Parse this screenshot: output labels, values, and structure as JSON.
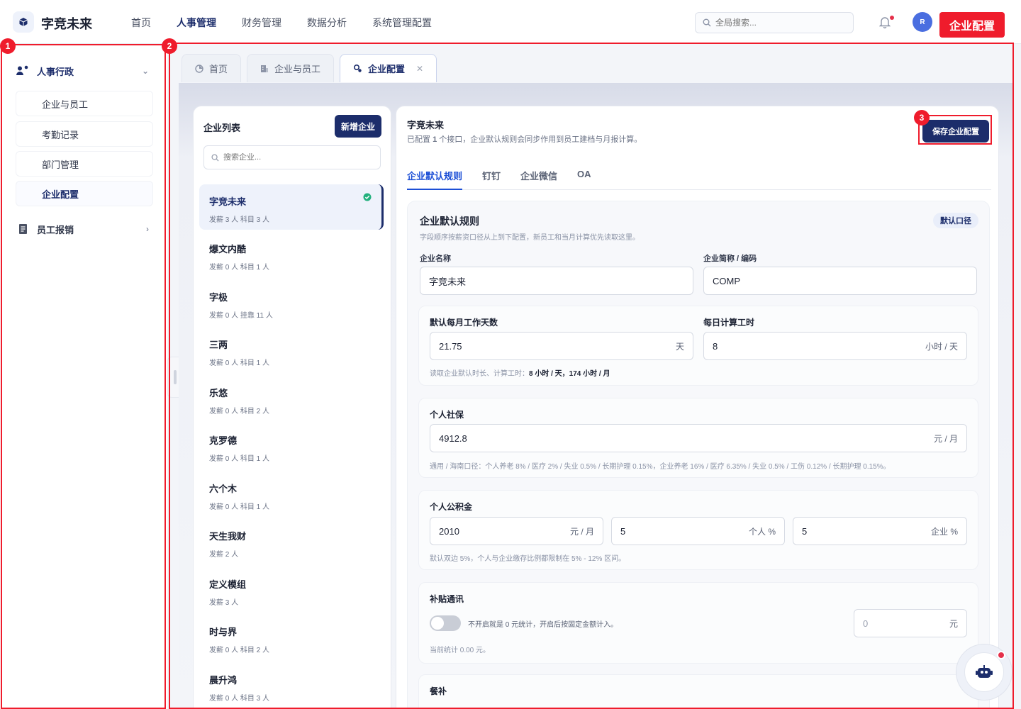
{
  "header": {
    "brand": "字竞未来",
    "nav": [
      "首页",
      "人事管理",
      "财务管理",
      "数据分析",
      "系统管理配置"
    ],
    "active_nav": 1,
    "search_placeholder": "全局搜索...",
    "avatar_initial": "R",
    "highlight_tag": "企业配置"
  },
  "sidebar": {
    "groups": [
      {
        "label": "人事行政",
        "expanded": true
      },
      {
        "label": "员工报销",
        "expanded": false
      }
    ],
    "items": [
      "企业与员工",
      "考勤记录",
      "部门管理",
      "企业配置"
    ],
    "active_item": 3
  },
  "annotations": {
    "region_1": "1",
    "region_2": "2",
    "region_3": "3"
  },
  "page_tabs": [
    {
      "label": "首页",
      "icon": "dashboard-icon"
    },
    {
      "label": "企业与员工",
      "icon": "building-icon"
    },
    {
      "label": "企业配置",
      "icon": "settings-icon",
      "active": true,
      "closable": true
    }
  ],
  "company_list": {
    "title": "企业列表",
    "new_button": "新增企业",
    "search_placeholder": "搜索企业...",
    "items": [
      {
        "name": "字竞未来",
        "meta": "发薪 3 人  科目 3 人",
        "active": true
      },
      {
        "name": "爆文内酷",
        "meta": "发薪 0 人  科目 1 人"
      },
      {
        "name": "字极",
        "meta": "发薪 0 人  挂靠 11 人"
      },
      {
        "name": "三两",
        "meta": "发薪 0 人  科目 1 人"
      },
      {
        "name": "乐悠",
        "meta": "发薪 0 人  科目 2 人"
      },
      {
        "name": "克罗德",
        "meta": "发薪 0 人  科目 1 人"
      },
      {
        "name": "六个木",
        "meta": "发薪 0 人  科目 1 人"
      },
      {
        "name": "天生我财",
        "meta": "发薪 2 人"
      },
      {
        "name": "定义模组",
        "meta": "发薪 3 人"
      },
      {
        "name": "时与界",
        "meta": "发薪 0 人  科目 2 人"
      },
      {
        "name": "晨升鸿",
        "meta": "发薪 0 人  科目 3 人"
      }
    ]
  },
  "detail": {
    "title": "字竞未来",
    "subtitle_pre": "已配置 ",
    "subtitle_count": "1",
    "subtitle_post": " 个接口，企业默认规则会同步作用到员工建档与月报计算。",
    "save_button": "保存企业配置",
    "tabs": [
      "企业默认规则",
      "钉钉",
      "企业微信",
      "OA"
    ],
    "active_tab": 0,
    "card": {
      "title": "企业默认规则",
      "subtitle": "字段顺序按薪资口径从上到下配置，新员工和当月计算优先读取这里。",
      "badge": "默认口径",
      "company_name_label": "企业名称",
      "company_name_value": "字竞未来",
      "company_code_label": "企业简称 / 编码",
      "company_code_value": "COMP",
      "work": {
        "days_label": "默认每月工作天数",
        "days_value": "21.75",
        "days_unit": "天",
        "hours_label": "每日计算工时",
        "hours_value": "8",
        "hours_unit": "小时 / 天",
        "note_pre": "读取企业默认时长、计算工时：",
        "note_bold": "8 小时 / 天，174 小时 / 月"
      },
      "social": {
        "label": "个人社保",
        "value": "4912.8",
        "unit": "元 / 月",
        "note": "通用 / 海南口径：个人养老 8% / 医疗 2% / 失业 0.5% / 长期护理 0.15%，企业养老 16% / 医疗 6.35% / 失业 0.5% / 工伤 0.12% / 长期护理 0.15%。"
      },
      "fund": {
        "label": "个人公积金",
        "base_value": "2010",
        "base_unit": "元 / 月",
        "personal_value": "5",
        "personal_unit": "个人 %",
        "company_value": "5",
        "company_unit": "企业 %",
        "note": "默认双边 5%，个人与企业缴存比例都限制在 5% - 12% 区间。"
      },
      "subsidy": {
        "label": "补贴通讯",
        "toggle_label": "不开启就是 0 元统计，开启后按固定金额计入。",
        "placeholder": "0",
        "unit": "元",
        "note": "当前统计 0.00 元。",
        "enabled": false
      },
      "meal": {
        "label": "餐补"
      }
    }
  }
}
